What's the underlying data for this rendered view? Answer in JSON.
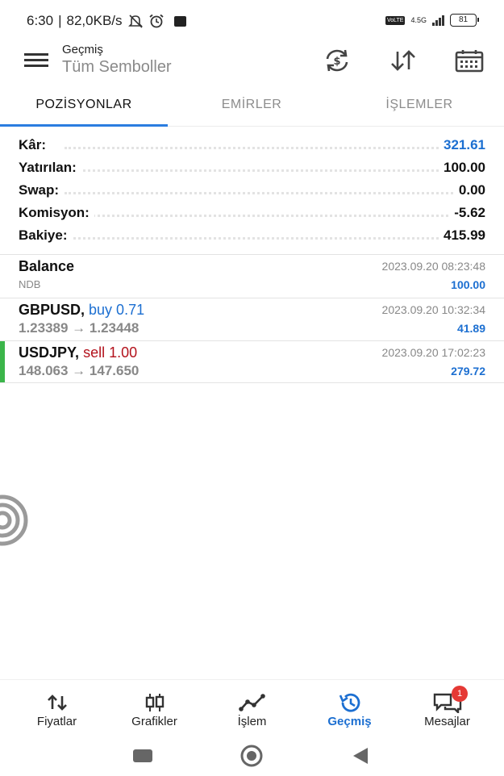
{
  "status_bar": {
    "time": "6:30",
    "speed": "82,0KB/s",
    "volte": "VoLTE",
    "network": "4.5G",
    "battery": "81"
  },
  "header": {
    "subtitle": "Geçmiş",
    "title": "Tüm Semboller",
    "icons": [
      "currency-exchange-icon",
      "sort-icon",
      "calendar-icon"
    ]
  },
  "tabs": [
    {
      "label": "POZİSYONLAR",
      "active": true
    },
    {
      "label": "EMİRLER",
      "active": false
    },
    {
      "label": "İŞLEMLER",
      "active": false
    }
  ],
  "summary": [
    {
      "label": "Kâr:",
      "value": "321.61",
      "color": "#1c6fd1"
    },
    {
      "label": "Yatırılan:",
      "value": "100.00"
    },
    {
      "label": "Swap:",
      "value": "0.00"
    },
    {
      "label": "Komisyon:",
      "value": "-5.62"
    },
    {
      "label": "Bakiye:",
      "value": "415.99"
    }
  ],
  "deals": [
    {
      "title": "Balance",
      "direction": "",
      "sub": "NDB",
      "time": "2023.09.20 08:23:48",
      "profit": "100.00"
    },
    {
      "title": "GBPUSD,",
      "direction": "buy 0.71",
      "direction_type": "buy",
      "sub": "1.23389 → 1.23448",
      "time": "2023.09.20 10:32:34",
      "profit": "41.89"
    },
    {
      "title": "USDJPY,",
      "direction": "sell 1.00",
      "direction_type": "sell",
      "sub": "148.063 → 147.650",
      "time": "2023.09.20 17:02:23",
      "profit": "279.72"
    }
  ],
  "bottom_nav": [
    {
      "label": "Fiyatlar",
      "icon": "quotes-arrows-icon"
    },
    {
      "label": "Grafikler",
      "icon": "candlestick-icon"
    },
    {
      "label": "İşlem",
      "icon": "trade-line-icon"
    },
    {
      "label": "Geçmiş",
      "icon": "history-icon",
      "active": true
    },
    {
      "label": "Mesajlar",
      "icon": "chat-icon",
      "badge": "1"
    }
  ],
  "colors": {
    "accent": "#1c6fd1",
    "tab_indicator": "#2b7de0",
    "sell": "#b3121c",
    "badge": "#e53935",
    "row_marker": "#3bb54a"
  }
}
